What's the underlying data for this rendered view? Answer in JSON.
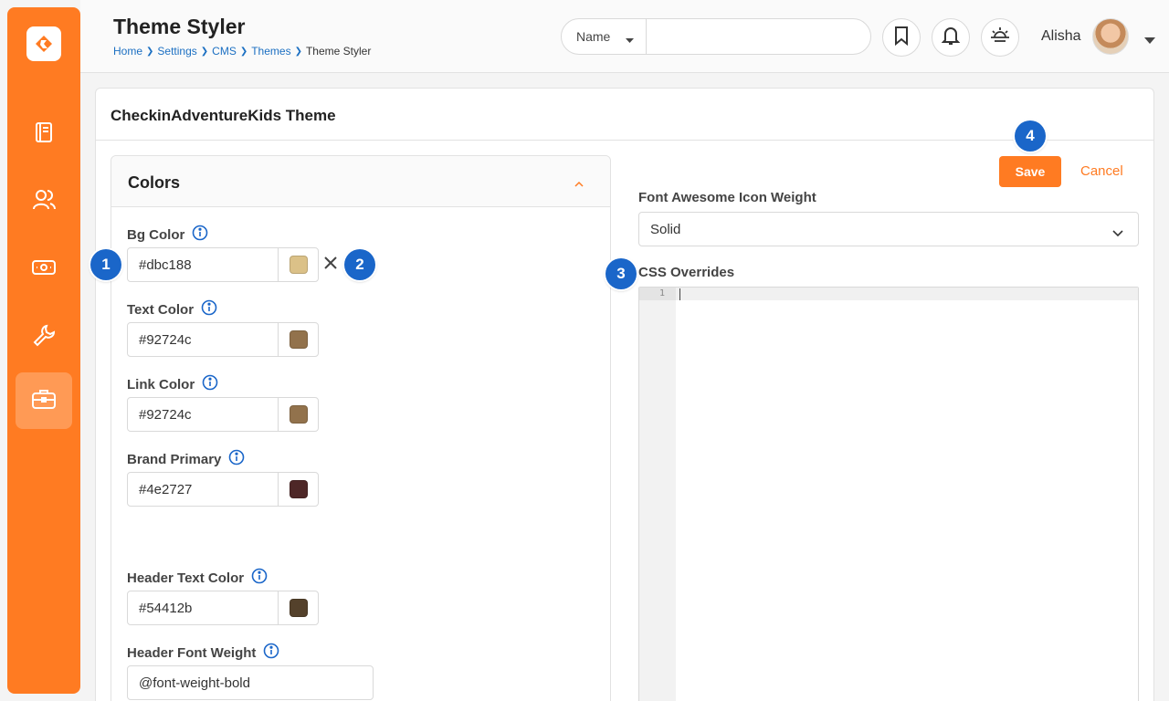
{
  "header": {
    "title": "Theme Styler",
    "breadcrumb": [
      "Home",
      "Settings",
      "CMS",
      "Themes",
      "Theme Styler"
    ],
    "search_type": "Name",
    "search_value": "",
    "user_name": "Alisha"
  },
  "sidebar": {
    "items": [
      "logo-icon",
      "book-icon",
      "people-icon",
      "finance-icon",
      "wrench-icon",
      "briefcase-icon"
    ]
  },
  "panel": {
    "title": "CheckinAdventureKids Theme",
    "save_label": "Save",
    "cancel_label": "Cancel",
    "colors_title": "Colors",
    "fields": {
      "bg_color": {
        "label": "Bg Color",
        "value": "#dbc188",
        "swatch": "#dbc188"
      },
      "text_color": {
        "label": "Text Color",
        "value": "#92724c",
        "swatch": "#92724c"
      },
      "link_color": {
        "label": "Link Color",
        "value": "#92724c",
        "swatch": "#92724c"
      },
      "brand_primary": {
        "label": "Brand Primary",
        "value": "#4e2727",
        "swatch": "#4e2727"
      },
      "header_text_color": {
        "label": "Header Text Color",
        "value": "#54412b",
        "swatch": "#54412b"
      },
      "header_font_weight": {
        "label": "Header Font Weight",
        "value": "@font-weight-bold"
      }
    },
    "icon_weight": {
      "label": "Font Awesome Icon Weight",
      "value": "Solid"
    },
    "css_overrides": {
      "label": "CSS Overrides",
      "line_number": "1"
    }
  },
  "annotations": [
    "1",
    "2",
    "3",
    "4"
  ],
  "colors": {
    "accent": "#ff7b22",
    "link": "#1b6fc2",
    "badge": "#1a66c9"
  }
}
